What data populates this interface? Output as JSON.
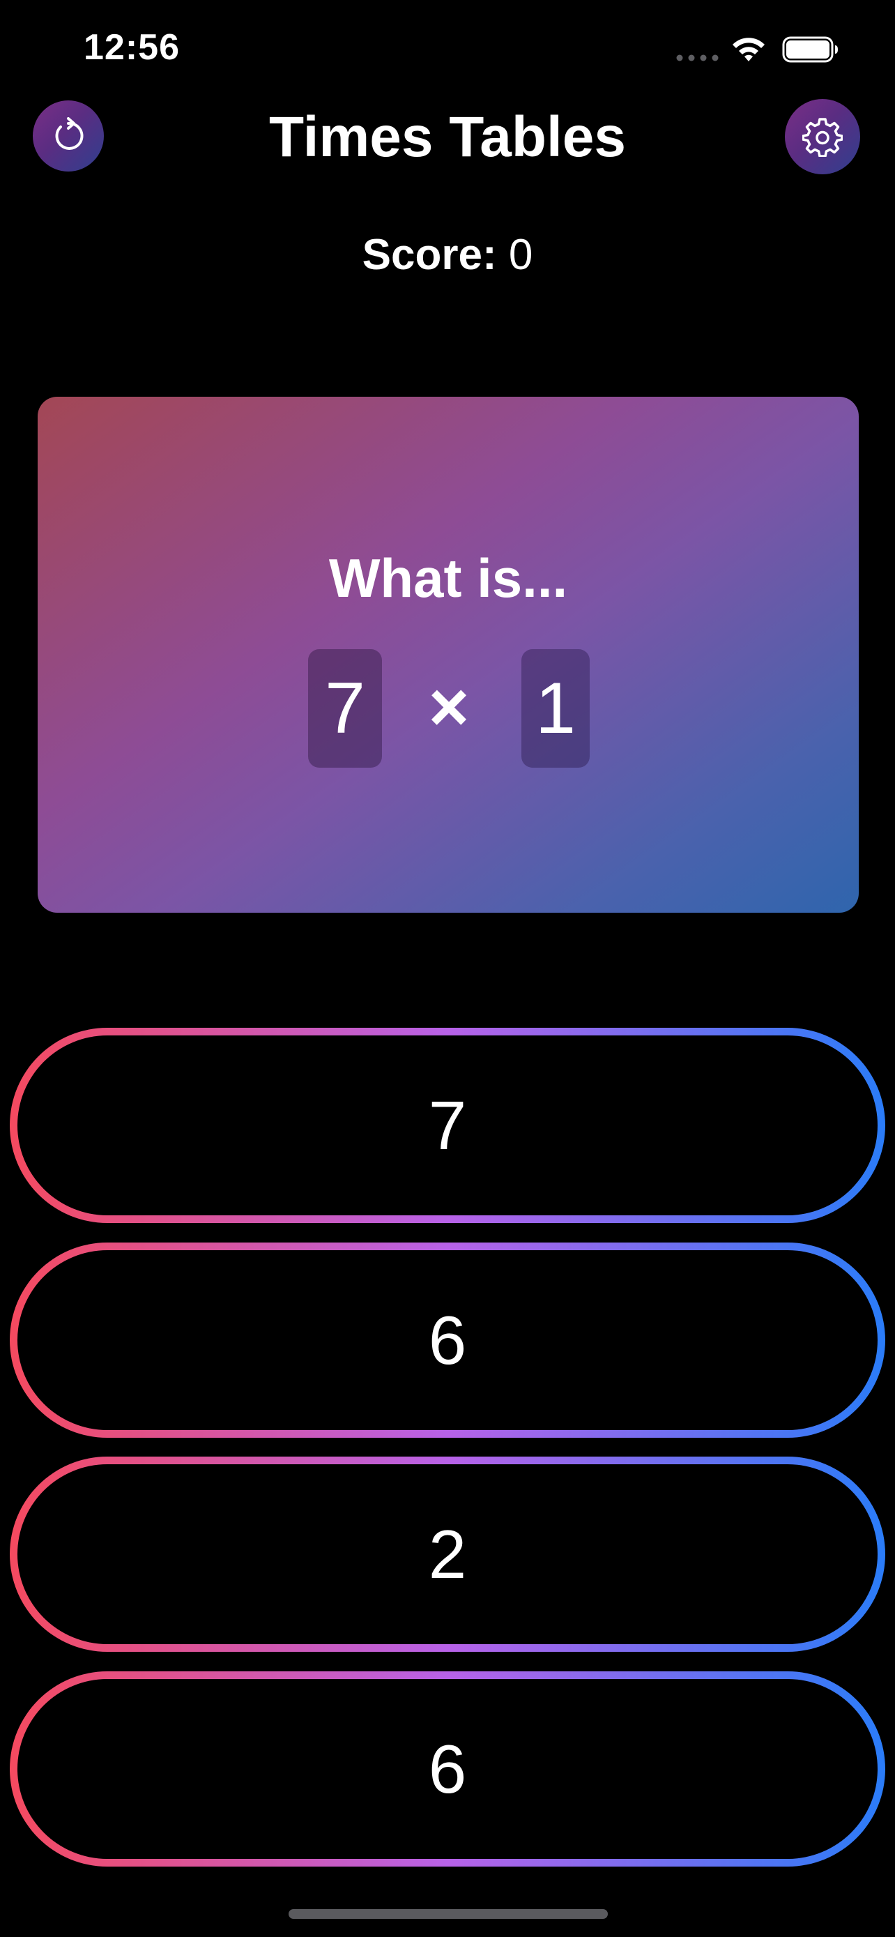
{
  "status_bar": {
    "time": "12:56"
  },
  "header": {
    "title": "Times Tables",
    "reset_icon": "reset-arrow-icon",
    "settings_icon": "gear-icon"
  },
  "score": {
    "label": "Score:",
    "value": "0"
  },
  "question": {
    "prompt": "What is...",
    "operand_a": "7",
    "operator": "×",
    "operand_b": "1"
  },
  "answers": [
    {
      "label": "7"
    },
    {
      "label": "6"
    },
    {
      "label": "2"
    },
    {
      "label": "6"
    }
  ],
  "colors": {
    "background": "#000000",
    "gradient_start": "#f54a5f",
    "gradient_mid": "#b862e8",
    "gradient_end": "#2a7cf8"
  }
}
